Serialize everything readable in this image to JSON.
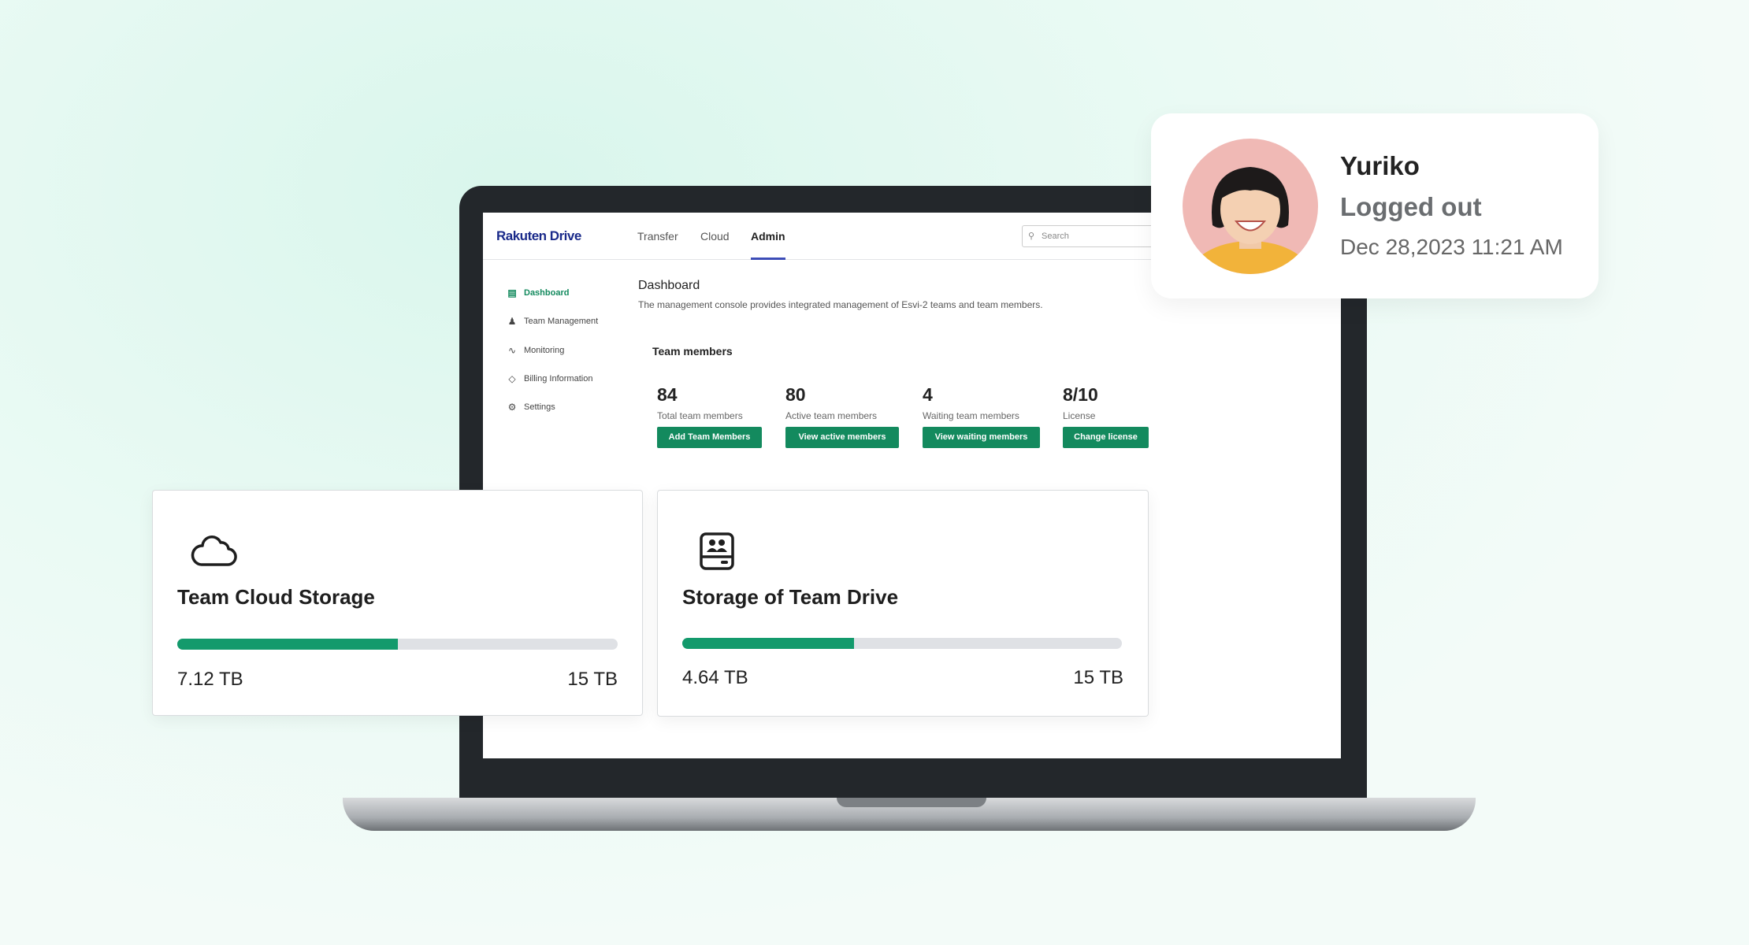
{
  "app": {
    "logo": "Rakuten Drive",
    "tabs": [
      {
        "label": "Transfer"
      },
      {
        "label": "Cloud"
      },
      {
        "label": "Admin",
        "active": true
      }
    ],
    "search_placeholder": "Search"
  },
  "sidebar": {
    "items": [
      {
        "label": "Dashboard",
        "icon": "dashboard-icon",
        "active": true
      },
      {
        "label": "Team Management",
        "icon": "user-icon"
      },
      {
        "label": "Monitoring",
        "icon": "pulse-icon"
      },
      {
        "label": "Billing Information",
        "icon": "tag-icon"
      },
      {
        "label": "Settings",
        "icon": "gear-icon"
      }
    ]
  },
  "main": {
    "title": "Dashboard",
    "description": "The management console provides integrated management of Esvi-2 teams and team members.",
    "section": "Team members",
    "stats": [
      {
        "value": "84",
        "label": "Total team members",
        "button": "Add Team Members"
      },
      {
        "value": "80",
        "label": "Active team members",
        "button": "View  active members"
      },
      {
        "value": "4",
        "label": "Waiting team members",
        "button": "View waiting members"
      },
      {
        "value": "8/10",
        "label": "License",
        "button": "Change license"
      }
    ]
  },
  "storage_cards": [
    {
      "title": "Team Cloud Storage",
      "icon": "cloud-icon",
      "used": "7.12 TB",
      "total": "15 TB",
      "progress_fraction": 0.5
    },
    {
      "title": "Storage of Team Drive",
      "icon": "team-drive-icon",
      "used": "4.64 TB",
      "total": "15 TB",
      "progress_fraction": 0.39
    }
  ],
  "profile": {
    "name": "Yuriko",
    "status": "Logged out",
    "timestamp": "Dec 28,2023 11:21 AM"
  },
  "colors": {
    "accent": "#138a5e",
    "progress": "#139a6c",
    "nav_underline": "#3d4db7"
  }
}
